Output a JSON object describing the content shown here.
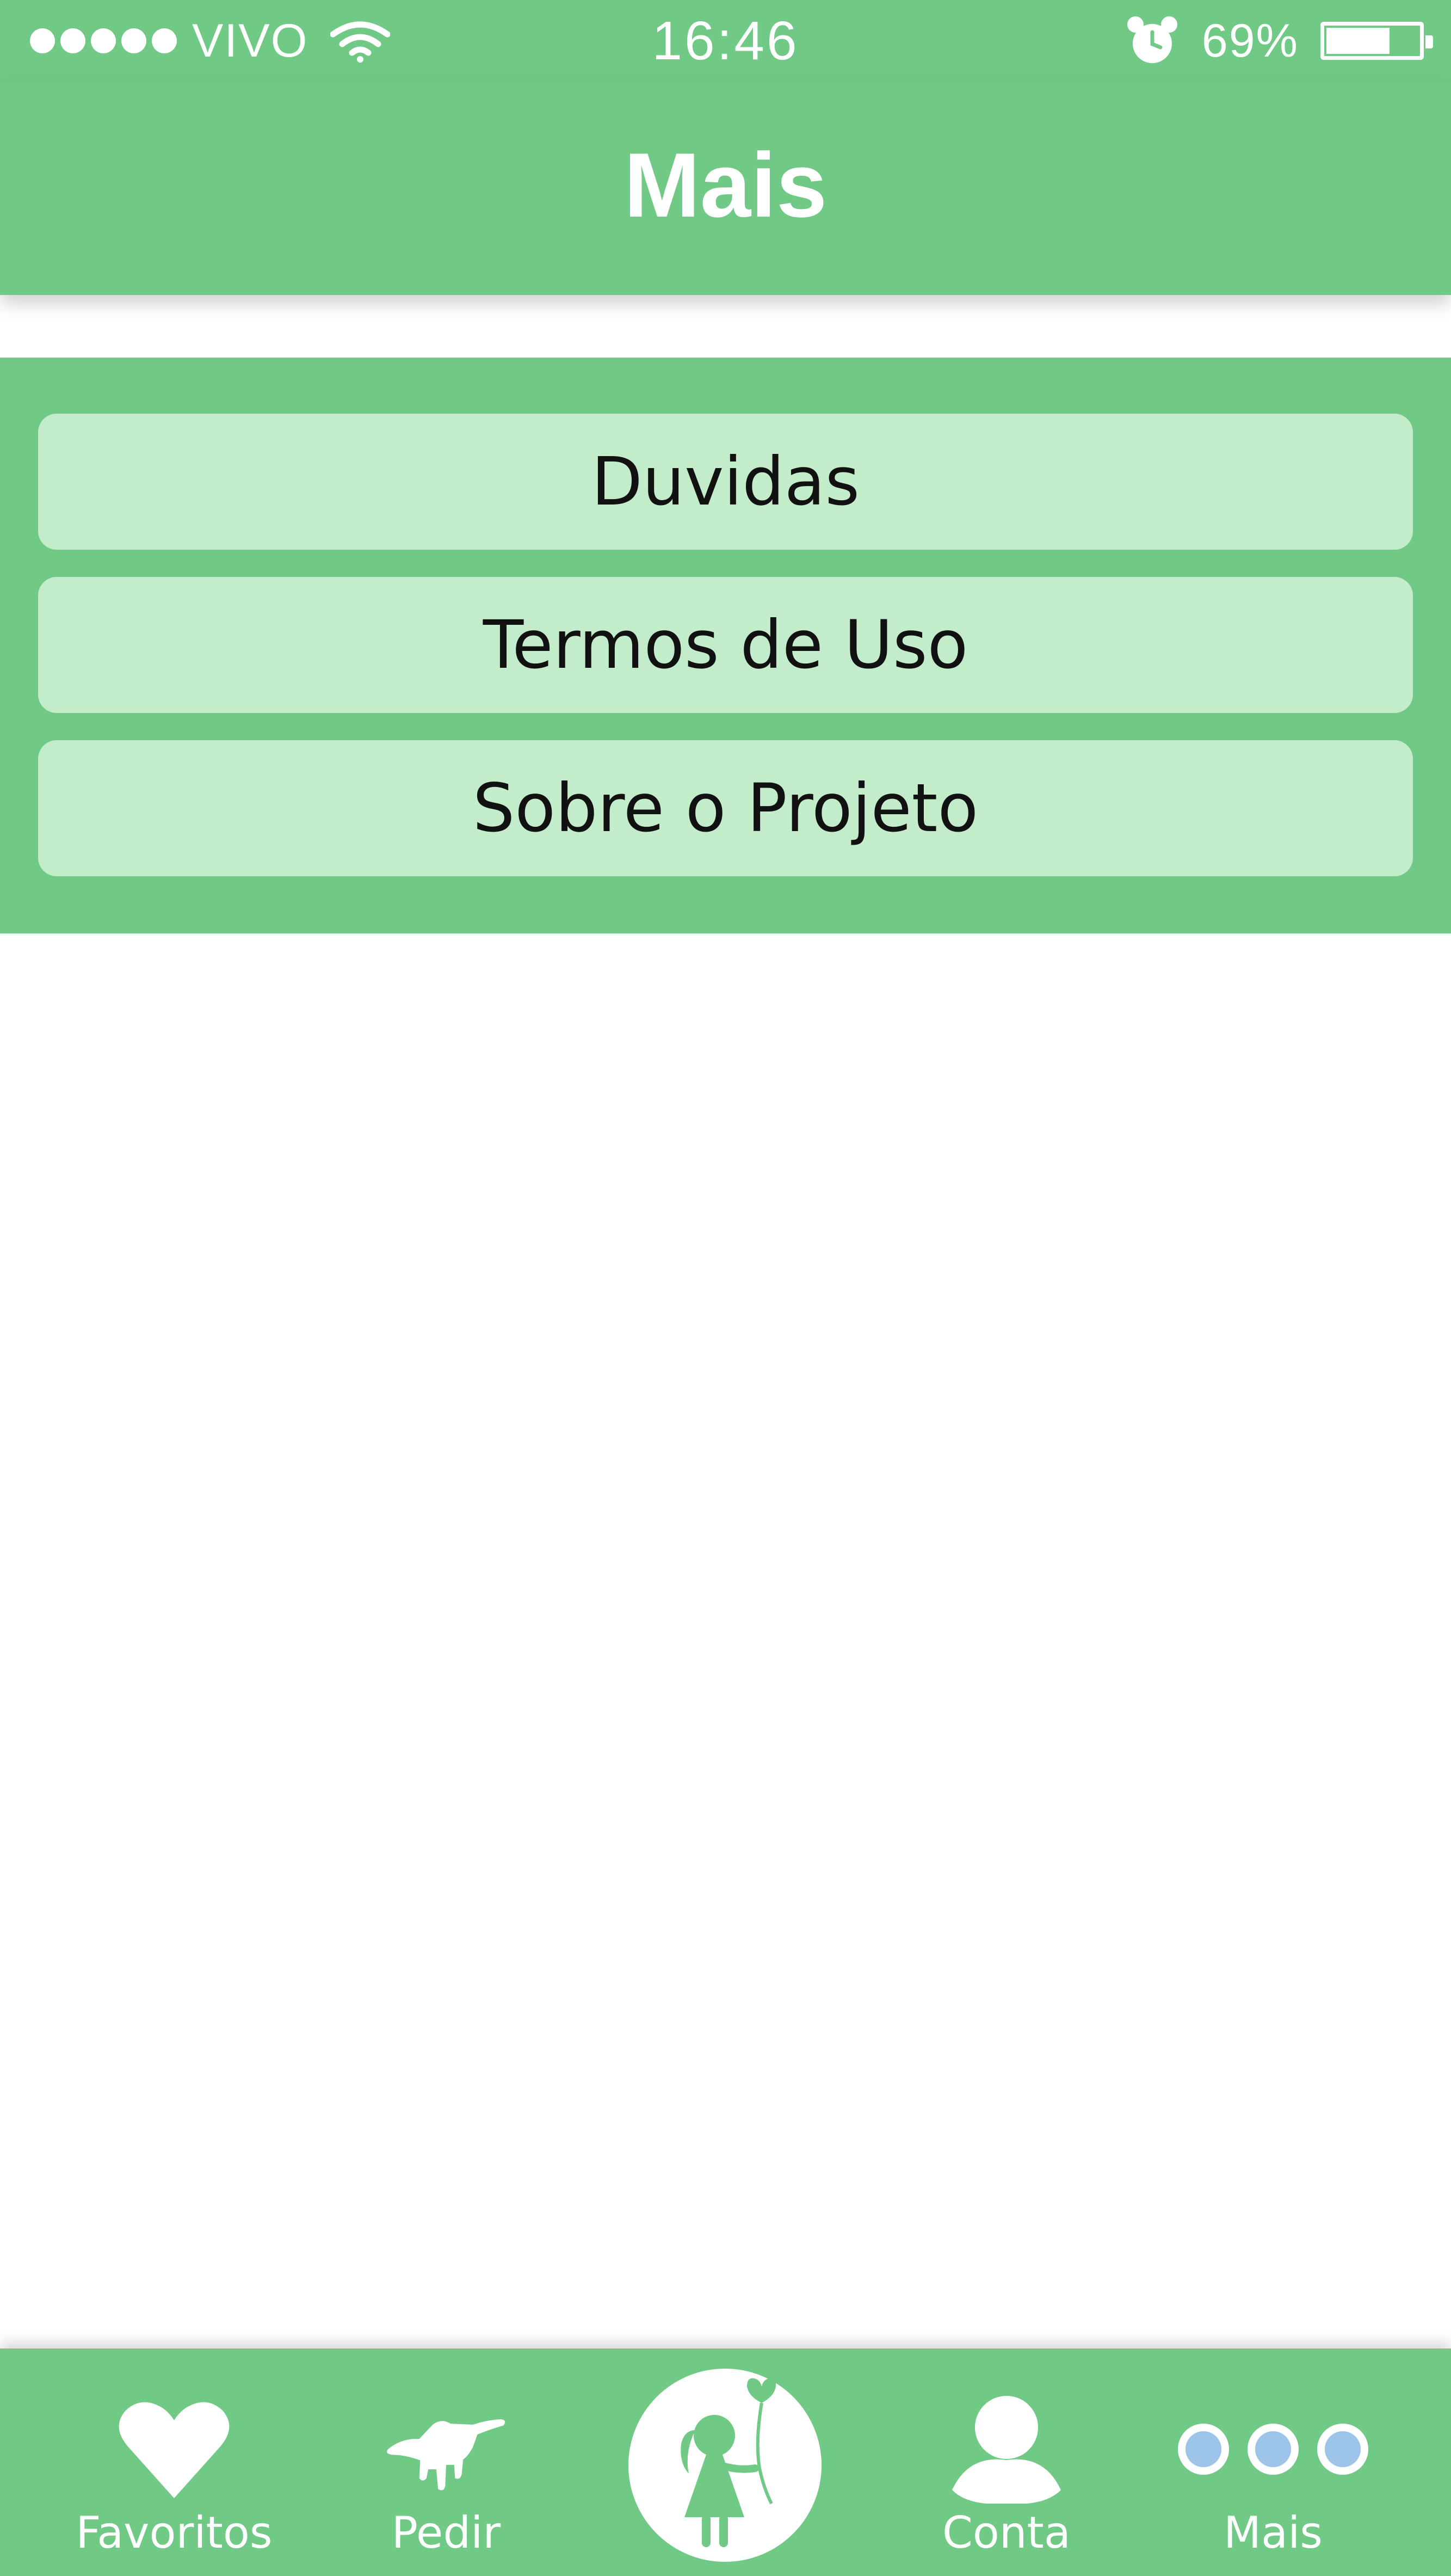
{
  "status_bar": {
    "carrier": "VIVO",
    "time": "16:46",
    "battery_percent": "69%",
    "battery_level": 0.69
  },
  "header": {
    "title": "Mais"
  },
  "menu": {
    "items": [
      {
        "label": "Duvidas"
      },
      {
        "label": "Termos de Uso"
      },
      {
        "label": "Sobre o Projeto"
      }
    ]
  },
  "tab_bar": {
    "tabs": [
      {
        "label": "Favoritos",
        "icon": "heart-icon"
      },
      {
        "label": "Pedir",
        "icon": "hand-icon"
      },
      {
        "label": "",
        "icon": "girl-with-balloon-icon"
      },
      {
        "label": "Conta",
        "icon": "user-icon"
      },
      {
        "label": "Mais",
        "icon": "more-dots-icon"
      }
    ]
  },
  "colors": {
    "primary_green": "#71c986",
    "button_green": "#c3ecca",
    "dots_blue": "#9cc3e8"
  }
}
